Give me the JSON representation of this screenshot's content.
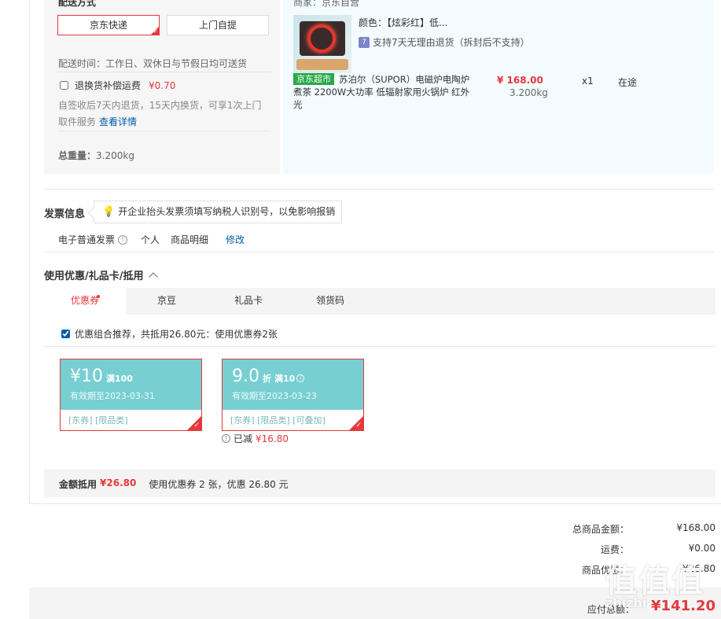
{
  "shipping": {
    "label": "配送方式",
    "option_jd": "京东快递",
    "option_self": "上门自提",
    "time": "配送时间：工作日、双休日与节假日均可送货",
    "return_insurance_label": "退换货补偿运费",
    "return_insurance_price": "¥0.70",
    "return_desc": "自签收后7天内退货，15天内换货，可享1次上门取件服务",
    "return_link": "查看详情",
    "weight_label": "总重量：",
    "weight_value": "3.200kg"
  },
  "product": {
    "seller": "商家：京东自营",
    "market_tag": "京东超市",
    "name": "苏泊尔（SUPOR）电磁炉电陶炉煮茶 2200W大功率 低辐射家用火锅炉 红外光",
    "color": "颜色：【炫彩红】低...",
    "seven_day_icon": "7",
    "seven_day": "支持7天无理由退货（拆封后不支持）",
    "price": "¥ 168.00",
    "weight": "3.200kg",
    "qty": "x1",
    "status": "在途"
  },
  "invoice": {
    "title": "发票信息",
    "tip": "开企业抬头发票须填写纳税人识别号，以免影响报销",
    "type": "电子普通发票",
    "person": "个人",
    "detail": "商品明细",
    "edit": "修改"
  },
  "coupons": {
    "title": "使用优惠/礼品卡/抵用",
    "tabs": [
      "优惠券",
      "京豆",
      "礼品卡",
      "领货码"
    ],
    "recommend": "优惠组合推荐，共抵用26.80元：使用优惠券2张",
    "items": [
      {
        "amount": "¥10",
        "cond": "满100",
        "expire": "有效期至2023-03-31",
        "tags": "[东券]  [限品类]"
      },
      {
        "amount": "9.0",
        "unit": "折",
        "cond": "满10",
        "expire": "有效期至2023-03-23",
        "tags": "[东券]  [限品类]  [可叠加]"
      }
    ],
    "reduced_label": "已减",
    "reduced_value": "¥16.80",
    "summary_label": "金额抵用",
    "summary_amount": "¥26.80",
    "summary_desc": "使用优惠券 2 张，优惠 26.80 元"
  },
  "totals": {
    "goods_label": "总商品金额：",
    "goods_value": "¥168.00",
    "shipping_label": "运费：",
    "shipping_value": "¥0.00",
    "discount_label": "商品优惠：",
    "discount_value": "-¥26.80",
    "pay_label": "应付总额：",
    "pay_value": "¥141.20"
  },
  "watermark": {
    "main": "值值值",
    "sub": "zhizhi"
  },
  "colors": {
    "accent_red": "#e4393c",
    "link_blue": "#005ea7",
    "coupon_teal": "#77cfd2",
    "market_green": "#2aa84a"
  },
  "icons": [
    "checkmark-icon",
    "bulb-icon",
    "info-icon",
    "chevron-up-icon",
    "seven-day-return-icon"
  ]
}
